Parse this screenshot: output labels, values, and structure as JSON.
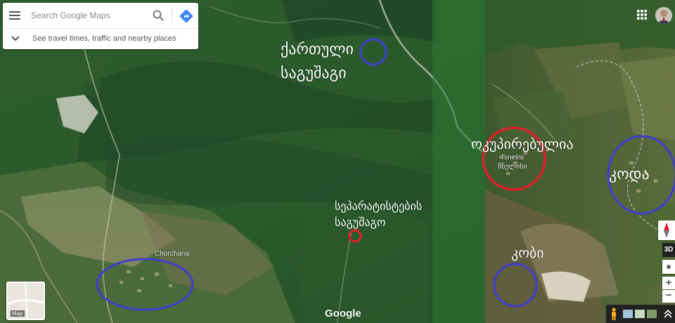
{
  "search": {
    "placeholder": "Search Google Maps",
    "travel_hint": "See travel times, traffic and nearby places"
  },
  "annotations": {
    "georgian_village_line1": "ქართული",
    "georgian_village_line2": "საგუშაგი",
    "separatist_line1": "სეპარატისტების",
    "separatist_line2": "საგუშაგო",
    "occupied": "ოკუპირებულია",
    "koda": "კოდა",
    "kobi": "კობი"
  },
  "places": {
    "chorchana": "Chorchana",
    "tsnelisi_en": "Tsnelisi",
    "tsnelisi_ka": "წნელისი"
  },
  "controls": {
    "tilt_label": "3D",
    "zoom_in": "+",
    "zoom_out": "−",
    "layer_label": "Map"
  },
  "brand": {
    "logo": "Google"
  },
  "icons": {
    "menu": "menu-icon",
    "search": "search-icon",
    "directions": "directions-icon",
    "expand": "chevron-down-icon",
    "apps": "apps-grid-icon",
    "compass": "compass-icon",
    "locate": "my-location-icon",
    "pegman": "pegman-icon"
  },
  "colors": {
    "circle_blue": "#3f3fd0",
    "circle_red": "#e0202a",
    "forest_dark": "#264d28",
    "forest_mid": "#3a6a35",
    "directions_blue": "#4285f4"
  }
}
